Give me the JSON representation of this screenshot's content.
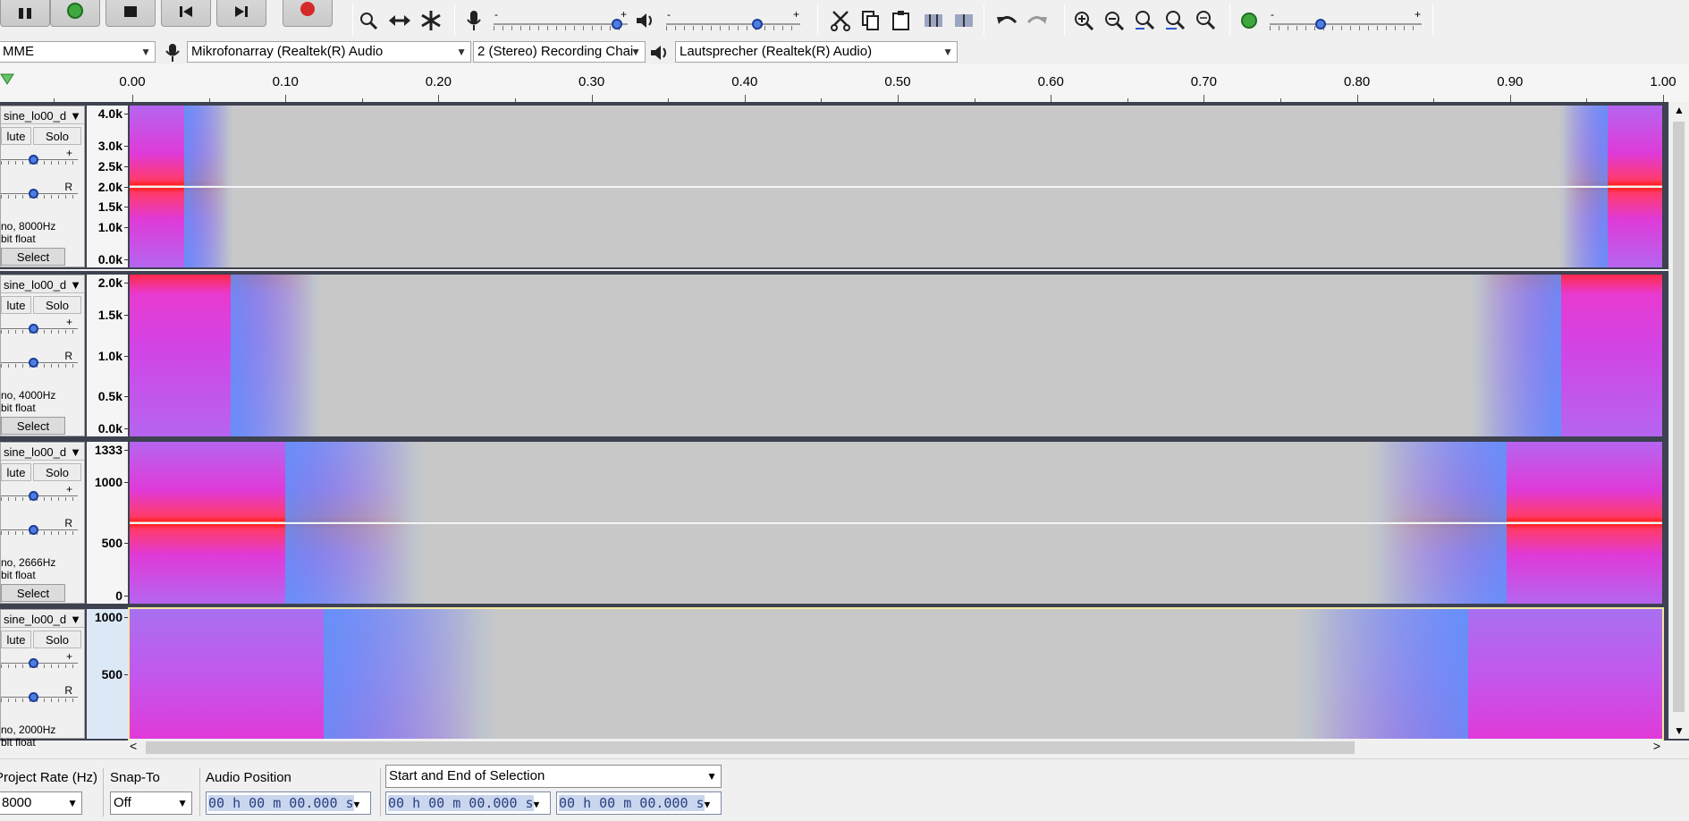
{
  "devices": {
    "host": "MME",
    "input_device": "Mikrofonarray (Realtek(R) Audio",
    "channels": "2 (Stereo) Recording Chai",
    "output_device": "Lautsprecher (Realtek(R) Audio)"
  },
  "meters": {
    "record_min": "-",
    "record_max": "+",
    "play_min": "-",
    "play_max": "+",
    "speed_min": "-",
    "speed_max": "+"
  },
  "ruler": {
    "labels": [
      "0.00",
      "0.10",
      "0.20",
      "0.30",
      "0.40",
      "0.50",
      "0.60",
      "0.70",
      "0.80",
      "0.90",
      "1.00"
    ]
  },
  "tracks": [
    {
      "name": "sine_lo00_d",
      "mute": "lute",
      "solo": "Solo",
      "pan_label": "R",
      "gain_label": "+",
      "info1": "no, 8000Hz",
      "info2": "bit float",
      "select": "Select",
      "scale": [
        "4.0k",
        "3.0k",
        "2.5k",
        "2.0k",
        "1.5k",
        "1.0k",
        "0.0k"
      ]
    },
    {
      "name": "sine_lo00_d",
      "mute": "lute",
      "solo": "Solo",
      "pan_label": "R",
      "gain_label": "+",
      "info1": "no, 4000Hz",
      "info2": "bit float",
      "select": "Select",
      "scale": [
        "2.0k",
        "1.5k",
        "1.0k",
        "0.5k",
        "0.0k"
      ]
    },
    {
      "name": "sine_lo00_d",
      "mute": "lute",
      "solo": "Solo",
      "pan_label": "R",
      "gain_label": "+",
      "info1": "no, 2666Hz",
      "info2": "bit float",
      "select": "Select",
      "scale": [
        "1333",
        "1000",
        "500",
        "0"
      ]
    },
    {
      "name": "sine_lo00_d",
      "mute": "lute",
      "solo": "Solo",
      "pan_label": "R",
      "gain_label": "+",
      "info1": "no, 2000Hz",
      "info2": "bit float",
      "scale": [
        "1000",
        "500"
      ]
    }
  ],
  "selection_bar": {
    "rate_label": "Project Rate (Hz)",
    "rate_value": "8000",
    "snap_label": "Snap-To",
    "snap_value": "Off",
    "audio_pos_label": "Audio Position",
    "sel_mode": "Start and End of Selection",
    "audio_pos": "00 h 00 m 00.000 s",
    "sel_start": "00 h 00 m 00.000 s",
    "sel_end": "00 h 00 m 00.000 s"
  },
  "colors": {
    "track_border": "#3d4150",
    "spec_empty": "#c8c8c8",
    "knob": "#4e7fe0"
  }
}
